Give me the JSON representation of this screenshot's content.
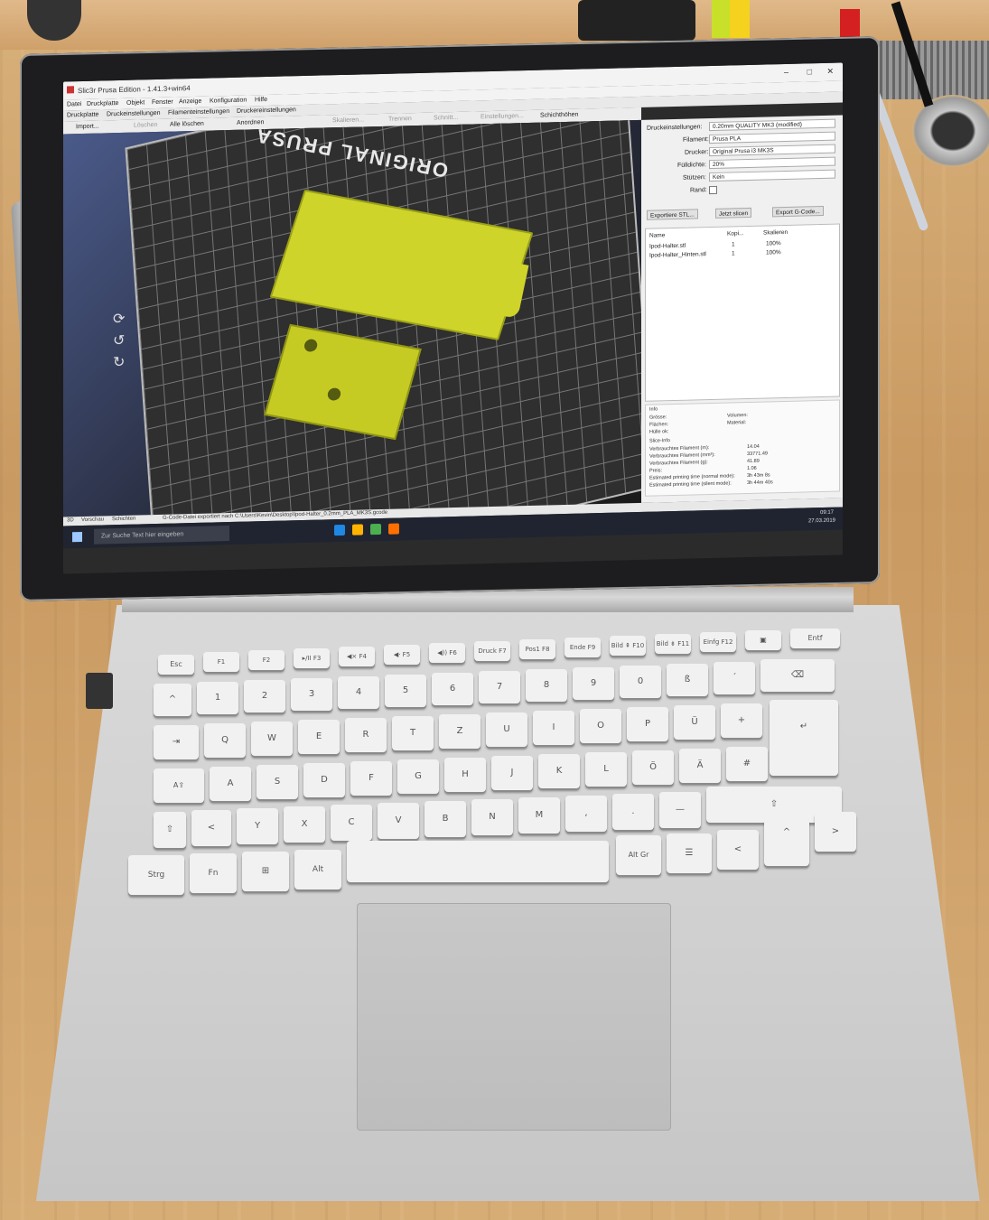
{
  "app": {
    "title": "Slic3r Prusa Edition - 1.41.3+win64",
    "window_controls": [
      "–",
      "□",
      "✕"
    ]
  },
  "menu": [
    "Datei",
    "Druckplatte",
    "Objekt",
    "Fenster",
    "Anzeige",
    "Konfiguration",
    "Hilfe"
  ],
  "tabs": [
    "Druckplatte",
    "Druckeinstellungen",
    "Filamenteinstellungen",
    "Druckereinstellungen"
  ],
  "toolbar": [
    "Import...",
    "Löschen",
    "Alle löschen",
    "Anordnen",
    "Skalieren...",
    "Trennen",
    "Schnitt...",
    "Einstellungen...",
    "Schichthöhen"
  ],
  "viewport": {
    "bed_text": "ORIGINAL PRUSA"
  },
  "settings": {
    "druck_label": "Druckeinstellungen:",
    "druck_value": "0.20mm QUALITY MK3 (modified)",
    "filament_label": "Filament:",
    "filament_value": "Prusa PLA",
    "drucker_label": "Drucker:",
    "drucker_value": "Original Prusa i3 MK3S",
    "fuell_label": "Fülldichte:",
    "fuell_value": "20%",
    "stuetz_label": "Stützen:",
    "stuetz_value": "Kein",
    "rand_label": "Rand:"
  },
  "actions": [
    "Exportiere STL...",
    "Jetzt slicen",
    "Export G-Code..."
  ],
  "object_list": {
    "headers": [
      "Name",
      "Kopi...",
      "Skalieren"
    ],
    "rows": [
      [
        "Ipod-Halter.stl",
        "1",
        "100%"
      ],
      [
        "Ipod-Halter_Hinten.stl",
        "1",
        "100%"
      ]
    ]
  },
  "info": {
    "title": "Info",
    "labels": [
      "Grösse:",
      "Flächen:",
      "Hülle ok:"
    ],
    "right_labels": [
      "Volumen:",
      "Material:"
    ],
    "slice_title": "Slice-Info",
    "slice_rows": [
      [
        "Verbrauchtes Filament (m):",
        "14.04"
      ],
      [
        "Verbrauchtes Filament (mm³):",
        "33771.49"
      ],
      [
        "Verbrauchtes Filament (g):",
        "41.89"
      ],
      [
        "Preis:",
        "1.06"
      ],
      [
        "Estimated printing time (normal mode):",
        "3h 43m 8s"
      ],
      [
        "Estimated printing time (silent mode):",
        "3h 44m 40s"
      ]
    ]
  },
  "bottom_tabs": [
    "3D",
    "Vorschau",
    "Schichten"
  ],
  "status": "G-Code-Datei exportiert nach C:\\Users\\Kevin\\Desktop\\Ipod-Halter_0.2mm_PLA_MK3S.gcode",
  "taskbar": {
    "search_placeholder": "Zur Suche Text hier eingeben",
    "time": "09:17",
    "date": "27.03.2019"
  },
  "keyboard": {
    "row_f": [
      "Esc",
      "F1",
      "F2",
      "▸/II F3",
      "◀× F4",
      "◀· F5",
      "◀)) F6",
      "Druck F7",
      "Pos1 F8",
      "Ende F9",
      "Bild ⇞ F10",
      "Bild ⇟ F11",
      "Einfg F12",
      "▣",
      "Entf"
    ],
    "row_num": [
      "^",
      "1",
      "2",
      "3",
      "4",
      "5",
      "6",
      "7",
      "8",
      "9",
      "0",
      "ß",
      "´",
      "⌫"
    ],
    "row_q": [
      "⇥",
      "Q",
      "W",
      "E",
      "R",
      "T",
      "Z",
      "U",
      "I",
      "O",
      "P",
      "Ü",
      "+",
      "↵"
    ],
    "row_a": [
      "A⇪",
      "A",
      "S",
      "D",
      "F",
      "G",
      "H",
      "J",
      "K",
      "L",
      "Ö",
      "Ä",
      "#"
    ],
    "row_y": [
      "⇧",
      "<",
      "Y",
      "X",
      "C",
      "V",
      "B",
      "N",
      "M",
      ",",
      ".",
      "—",
      "⇧"
    ],
    "row_ctrl": [
      "Strg",
      "Fn",
      "⊞",
      "Alt",
      "",
      "Alt Gr",
      "☰",
      "<",
      "^",
      ">"
    ]
  }
}
